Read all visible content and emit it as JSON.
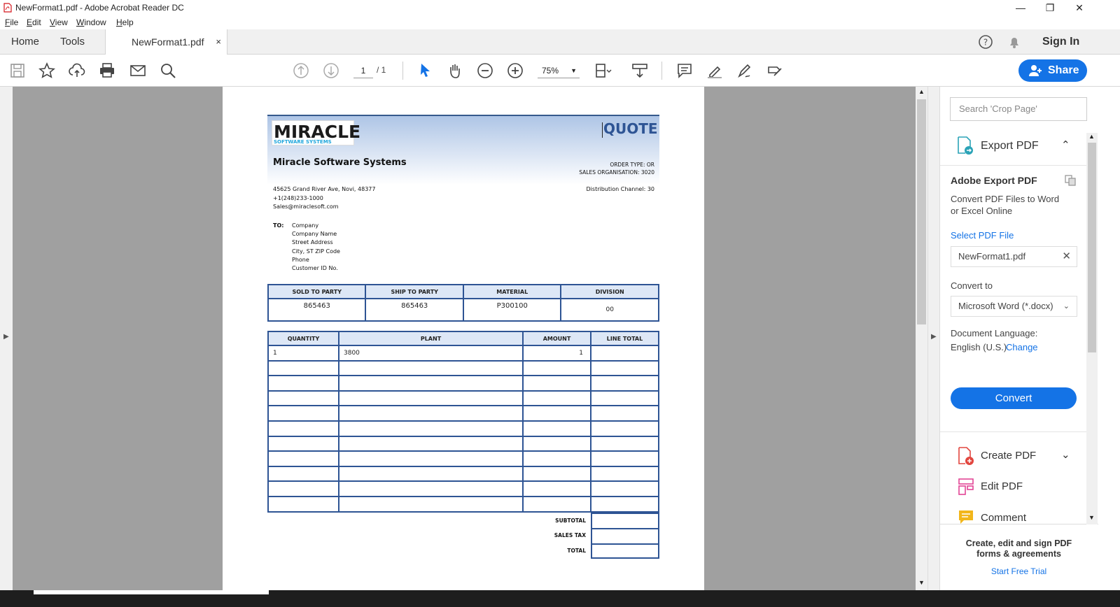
{
  "window": {
    "title": "NewFormat1.pdf - Adobe Acrobat Reader DC"
  },
  "menu": [
    "File",
    "Edit",
    "View",
    "Window",
    "Help"
  ],
  "tabs": {
    "home": "Home",
    "tools": "Tools",
    "document": "NewFormat1.pdf",
    "close": "×"
  },
  "header_right": {
    "sign_in": "Sign In"
  },
  "toolbar": {
    "page_current": "1",
    "page_total": "/ 1",
    "zoom": "75%",
    "share_label": "Share"
  },
  "right_panel": {
    "search_placeholder": "Search 'Crop Page'",
    "export_title": "Export PDF",
    "export_heading": "Adobe Export PDF",
    "export_desc": "Convert PDF Files to Word or Excel Online",
    "select_file": "Select PDF File",
    "file_name": "NewFormat1.pdf",
    "convert_to_label": "Convert to",
    "convert_format": "Microsoft Word (*.docx)",
    "doc_lang_label": "Document Language:",
    "doc_lang_value": "English (U.S.)",
    "change_link": "Change",
    "convert_btn": "Convert",
    "tools": [
      "Create PDF",
      "Edit PDF",
      "Comment"
    ],
    "promo": "Create, edit and sign PDF forms & agreements",
    "trial_link": "Start Free Trial"
  },
  "colors": {
    "accent": "#1473e6",
    "doc_border": "#2e5494",
    "doc_header_bg": "#aec5e6",
    "quote_title": "#2e5494"
  },
  "document": {
    "logo_main": "MIRACLE",
    "logo_sub": "SOFTWARE SYSTEMS",
    "quote_title": "QUOTE",
    "company_name": "Miracle Software Systems",
    "order_type": "ORDER TYPE: OR",
    "sales_org": "SALES ORGANISATION: 3020",
    "distribution": "Distribution Channel: 30",
    "address": [
      "45625 Grand River Ave, Novi, 48377",
      "+1(248)233-1000",
      "Sales@miraclesoft.com"
    ],
    "to_label": "TO:",
    "to_lines": [
      "Company",
      "Company Name",
      "Street Address",
      "City, ST ZIP Code",
      "Phone",
      "Customer ID No."
    ],
    "party_table": {
      "headers": [
        "SOLD TO PARTY",
        "SHIP TO PARTY",
        "MATERIAL",
        "DIVISION"
      ],
      "values": [
        "865463",
        "865463",
        "P300100",
        "00"
      ]
    },
    "items_table": {
      "headers": [
        "QUANTITY",
        "PLANT",
        "AMOUNT",
        "LINE TOTAL"
      ],
      "rows": [
        [
          "1",
          "3800",
          "1",
          ""
        ]
      ],
      "empty_rows": 10
    },
    "totals": [
      "SUBTOTAL",
      "SALES TAX",
      "TOTAL"
    ]
  }
}
